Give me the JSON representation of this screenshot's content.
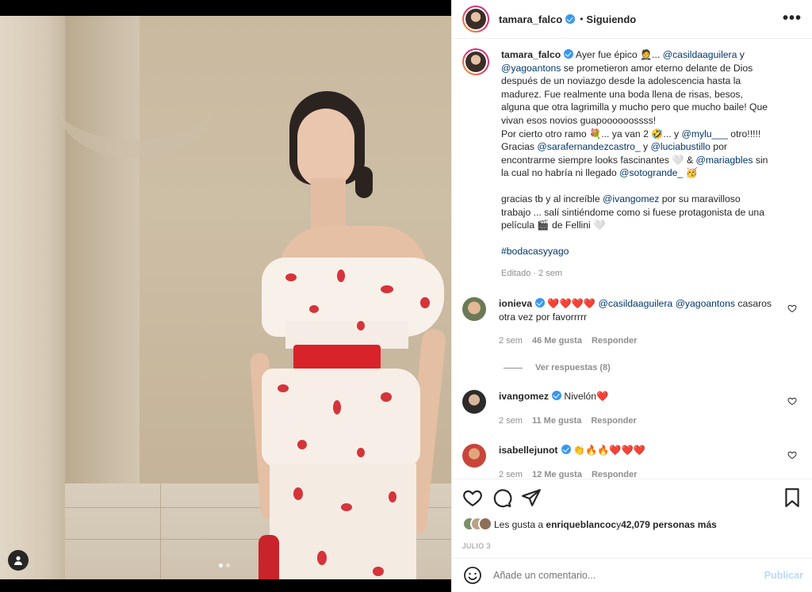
{
  "post": {
    "author": "tamara_falco",
    "follow_status": "Siguiendo",
    "separator": "•",
    "more_glyph": "•••",
    "carousel_dots": 2
  },
  "caption": {
    "author": "tamara_falco",
    "lines": [
      [
        "Ayer fue épico 🤵‍♂️.... ",
        "@casildaaguilera",
        " y"
      ],
      [
        "",
        "@yagoantons",
        " se prometieron amor eterno delante de Dios después de un noviazgo desde la adolescencia hasta la madurez. Fue realmente una boda llena de risas, besos, alguna que otra lagrimilla y mucho pero que mucho baile! Que vivan esos novios guapoooooossss!"
      ],
      [
        "Por cierto otro ramo 💐... ya van 2 🤣... y ",
        "@mylu___",
        " otro!!!!!"
      ],
      [
        "Gracias ",
        "@sarafernandezcastro_",
        " y "
      ],
      [
        "",
        "@luciabustillo",
        " por encontrarme siempre looks fascinantes 🤍 & "
      ],
      [
        "",
        "@mariagbles",
        " sin la cual no habría ni llegado "
      ],
      [
        "",
        "@sotogrande_",
        " 🥳"
      ]
    ],
    "p1_a": "Ayer fue épico 🤵... ",
    "p1_m1": "@casildaaguilera",
    "p1_b": " y ",
    "p1_m2": "@yagoantons",
    "p1_c": " se prometieron amor eterno delante de Dios después de un noviazgo desde la adolescencia hasta la madurez. Fue realmente una boda llena de risas, besos, alguna que otra lagrimilla y mucho pero que mucho baile! Que vivan esos novios guapoooooossss!",
    "p2_a": "Por cierto otro ramo 💐... ya van 2 🤣... y ",
    "p2_m1": "@mylu___",
    "p2_b": " otro!!!!!",
    "p3_a": "Gracias ",
    "p3_m1": "@sarafernandezcastro_",
    "p3_b": " y ",
    "p3_m2": "@luciabustillo",
    "p3_c": " por encontrarme siempre looks fascinantes 🤍 & ",
    "p3_m3": "@mariagbles",
    "p3_d": " sin la cual no habría ni llegado ",
    "p3_m4": "@sotogrande_",
    "p3_e": " 🥳",
    "p4_a": "gracias tb y al increíble ",
    "p4_m1": "@ivangomez",
    "p4_b": " por su maravilloso trabajo ... salí sintiéndome como si fuese protagonista de una película 🎬 de Fellini 🤍",
    "hashtag": "#bodacasyyago",
    "edited": "Editado · 2 sem"
  },
  "comments": [
    {
      "user": "ionieva",
      "text_a": "❤️❤️❤️❤️ ",
      "m1": "@casildaaguilera",
      "text_b": " ",
      "m2": "@yagoantons",
      "text_c": " casaros otra vez por favorrrrr",
      "time": "2 sem",
      "likes": "46 Me gusta",
      "reply": "Responder",
      "view_replies": "Ver respuestas (8)"
    },
    {
      "user": "ivangomez",
      "text_a": "Nivelón❤️",
      "time": "2 sem",
      "likes": "11 Me gusta",
      "reply": "Responder"
    },
    {
      "user": "isabellejunot",
      "text_a": "👏🔥🔥❤️❤️❤️",
      "time": "2 sem",
      "likes": "12 Me gusta",
      "reply": "Responder"
    }
  ],
  "likes": {
    "prefix": "Les gusta a ",
    "user": "enriqueblancoc",
    "middle": " y ",
    "count": "42,079 personas más"
  },
  "date": "JULIO 3",
  "composer": {
    "placeholder": "Añade un comentario...",
    "publish": "Publicar"
  },
  "colors": {
    "accent": "#0095f6",
    "mention": "#00376b",
    "verified": "#3897f0",
    "muted": "#8e8e8e",
    "publish_disabled": "#b3dbff"
  }
}
